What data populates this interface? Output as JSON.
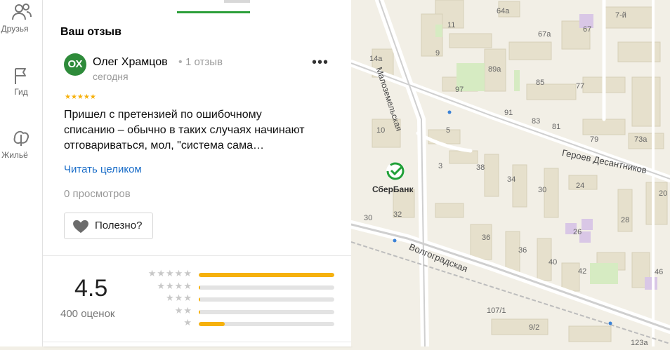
{
  "rail": {
    "items": [
      {
        "label": "Друзья",
        "icon": "friends-icon"
      },
      {
        "label": "Гид",
        "icon": "flag-icon"
      },
      {
        "label": "Жильё",
        "icon": "housing-icon"
      }
    ]
  },
  "review_section": {
    "title": "Ваш отзыв",
    "author": {
      "initials": "ОХ",
      "name": "Олег Храмцов",
      "separator": "•",
      "reviews_count": "1 отзыв",
      "date": "сегодня"
    },
    "more_label": "•••",
    "stars": "★★★★★",
    "rating_stars": 5,
    "text_lines": [
      "Пришел с претензией по ошибочному",
      "списанию – обычно в таких случаях начинают",
      "отговариваться, мол, \"система сама…"
    ],
    "read_more": "Читать целиком",
    "views": "0 просмотров",
    "useful_label": "Полезно?"
  },
  "rating_summary": {
    "value": "4.5",
    "count_label": "400 оценок",
    "distribution": [
      {
        "stars": "★★★★★",
        "fill": 1.0
      },
      {
        "stars": "★★★★",
        "fill": 0.01
      },
      {
        "stars": "★★★",
        "fill": 0.01
      },
      {
        "stars": "★★",
        "fill": 0.01
      },
      {
        "stars": "★",
        "fill": 0.19
      }
    ]
  },
  "map": {
    "poi": {
      "name": "СберБанк"
    },
    "streets": [
      "Малоземельская",
      "Героев Десантников",
      "Волгоградская"
    ],
    "house_numbers": [
      "64а",
      "7-й",
      "11",
      "67а",
      "67",
      "9",
      "14а",
      "89а",
      "85",
      "77",
      "97",
      "91",
      "83",
      "81",
      "79",
      "73а",
      "10",
      "5",
      "38",
      "24",
      "3",
      "34",
      "30",
      "20",
      "32",
      "28",
      "26",
      "30",
      "36",
      "36",
      "40",
      "42",
      "46",
      "107/1",
      "9/2",
      "123а"
    ],
    "colors": {
      "road": "#c9c9c9",
      "ground": "#f2efe6",
      "building": "#e4ddc8",
      "park": "#d6ebc2",
      "accent": "#2c9f3a",
      "sber": "#21a038"
    }
  }
}
